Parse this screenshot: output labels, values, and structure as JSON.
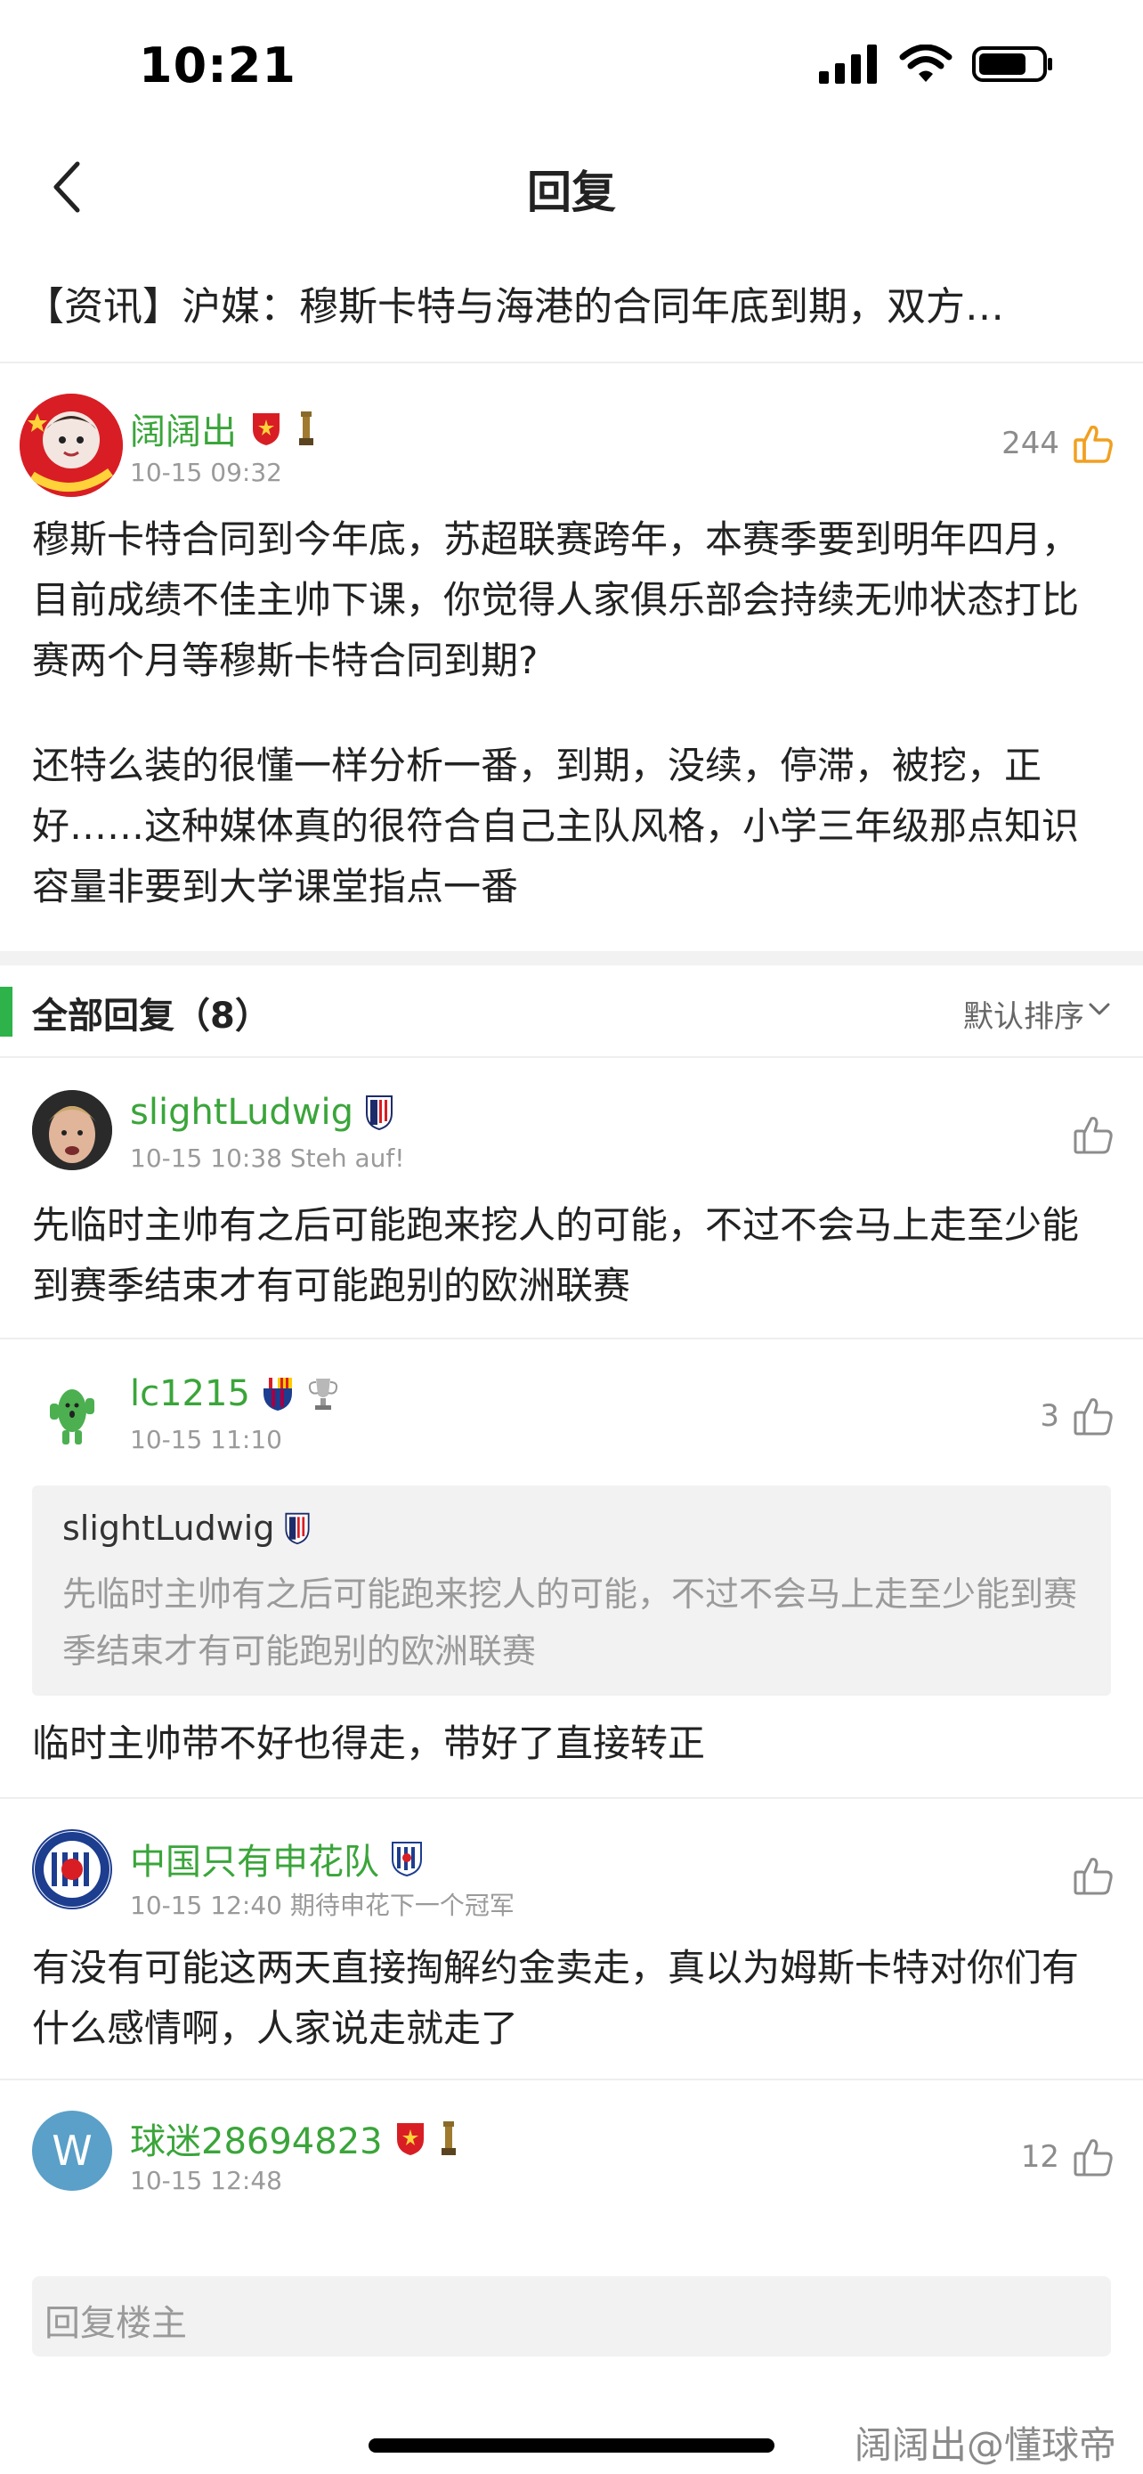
{
  "status_bar": {
    "time": "10:21"
  },
  "nav": {
    "title": "回复"
  },
  "topic": {
    "title": "【资讯】沪媒：穆斯卡特与海港的合同年底到期，双方…"
  },
  "post": {
    "author": "阔阔出",
    "time": "10-15 09:32",
    "likes": "244",
    "paragraph1": "穆斯卡特合同到今年底，苏超联赛跨年，本赛季要到明年四月，目前成绩不佳主帅下课，你觉得人家俱乐部会持续无帅状态打比赛两个月等穆斯卡特合同到期?",
    "paragraph2": "还特么装的很懂一样分析一番，到期，没续，停滞，被挖，正好……这种媒体真的很符合自己主队风格，小学三年级那点知识容量非要到大学课堂指点一番"
  },
  "replies_header": {
    "title": "全部回复（8）",
    "sort_label": "默认排序"
  },
  "replies": [
    {
      "author": "slightLudwig",
      "time": "10-15 10:38",
      "signature": "Steh auf!",
      "likes": "",
      "text": "先临时主帅有之后可能跑来挖人的可能，不过不会马上走至少能到赛季结束才有可能跑别的欧洲联赛"
    },
    {
      "author": "lc1215",
      "time": "10-15 11:10",
      "signature": "",
      "likes": "3",
      "quote": {
        "author": "slightLudwig",
        "text": "先临时主帅有之后可能跑来挖人的可能，不过不会马上走至少能到赛季结束才有可能跑别的欧洲联赛"
      },
      "text": "临时主帅带不好也得走，带好了直接转正"
    },
    {
      "author": "中国只有申花队",
      "time": "10-15 12:40",
      "signature": "期待申花下一个冠军",
      "likes": "",
      "text": "有没有可能这两天直接掏解约金卖走，真以为姆斯卡特对你们有什么感情啊，人家说走就走了"
    },
    {
      "author": "球迷28694823",
      "time": "10-15 12:48",
      "signature": "",
      "likes": "12",
      "avatar_letter": "W"
    }
  ],
  "input": {
    "placeholder": "回复楼主"
  },
  "watermark": "阔阔出@懂球帝",
  "colors": {
    "username": "#3aa53a",
    "accent_bar": "#2db34a",
    "like_active": "#f0a020"
  }
}
